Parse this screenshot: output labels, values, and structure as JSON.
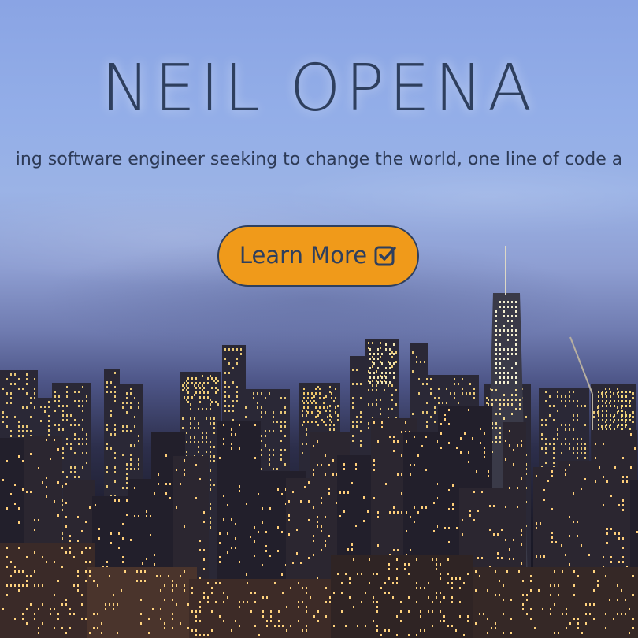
{
  "hero": {
    "title": "NEIL OPENA",
    "tagline": "ing software engineer seeking to change the world, one line of code a",
    "cta_label": "Learn More",
    "cta_icon": "check-square-icon"
  },
  "colors": {
    "title_text": "#2e3f5e",
    "cta_background": "#f09a1a",
    "cta_border": "#2e3f5e",
    "sky_top": "#8aa4e4",
    "city_dark": "#14121c"
  }
}
